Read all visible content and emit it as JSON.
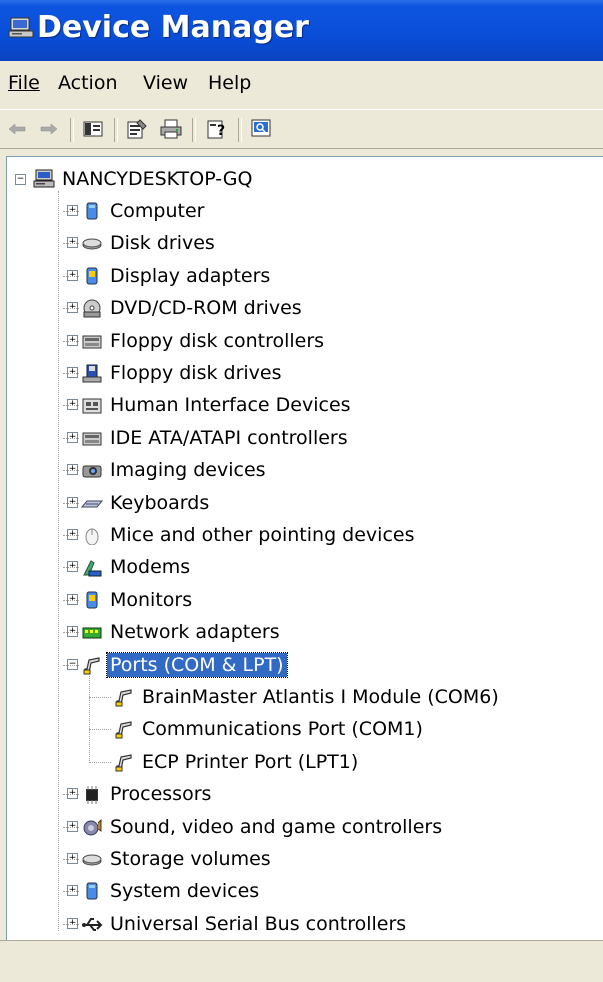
{
  "window": {
    "title": "Device Manager"
  },
  "menu": {
    "file": "File",
    "action": "Action",
    "view": "View",
    "help": "Help"
  },
  "toolbar": {
    "buttons": [
      "back-icon",
      "forward-icon",
      "show-hide-console-tree-icon",
      "properties-icon",
      "print-icon",
      "help-icon",
      "scan-hardware-icon"
    ]
  },
  "tree": {
    "root": "NANCYDESKTOP-GQ",
    "categories": [
      "Computer",
      "Disk drives",
      "Display adapters",
      "DVD/CD-ROM drives",
      "Floppy disk controllers",
      "Floppy disk drives",
      "Human Interface Devices",
      "IDE ATA/ATAPI controllers",
      "Imaging devices",
      "Keyboards",
      "Mice and other pointing devices",
      "Modems",
      "Monitors",
      "Network adapters",
      "Ports (COM & LPT)",
      "Processors",
      "Sound, video and game controllers",
      "Storage volumes",
      "System devices",
      "Universal Serial Bus controllers"
    ],
    "ports_children": [
      "BrainMaster Atlantis I Module (COM6)",
      "Communications Port (COM1)",
      "ECP Printer Port (LPT1)"
    ],
    "selected": "Ports (COM & LPT)"
  },
  "colors": {
    "titlebar": "#0a4ed8",
    "selection": "#316ac5",
    "chrome": "#ece9d8"
  }
}
